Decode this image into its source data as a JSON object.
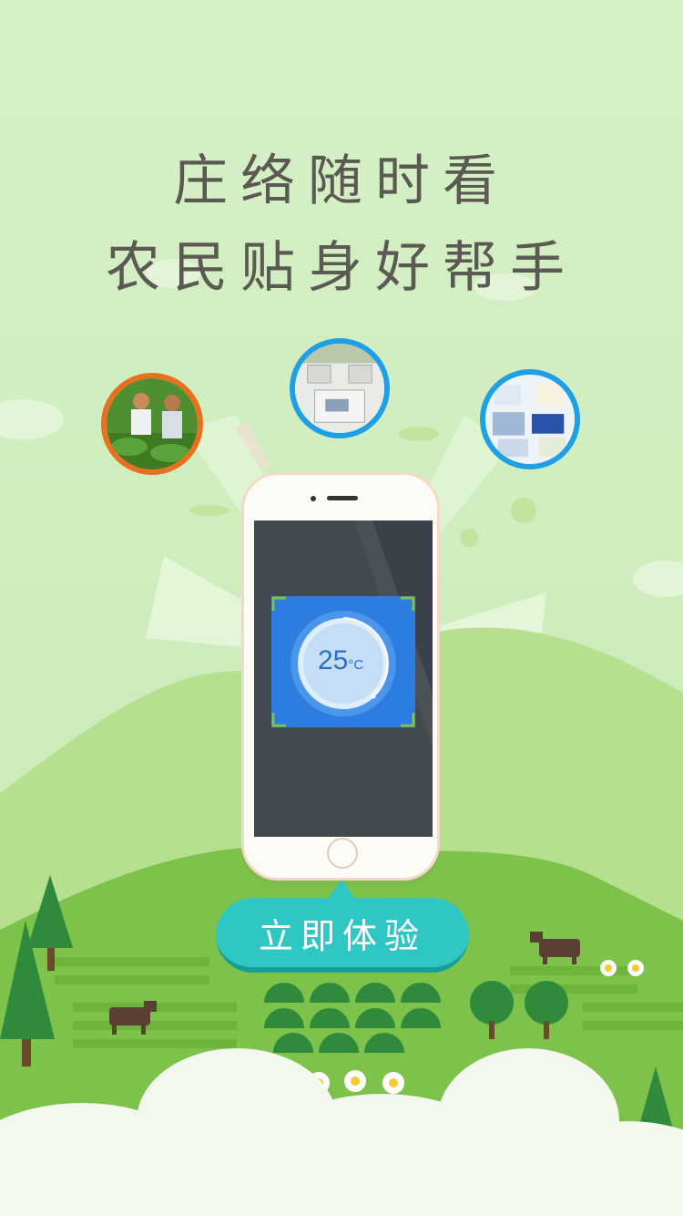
{
  "headline": {
    "line1": "庄络随时看",
    "line2": "农民贴身好帮手"
  },
  "phone_screen": {
    "temperature_value": "25",
    "temperature_unit": "°C"
  },
  "cta": {
    "label": "立即体验"
  },
  "bubbles": [
    {
      "name": "farmers-photo",
      "border_color": "#e8701e"
    },
    {
      "name": "device-photo",
      "border_color": "#1fa0e6"
    },
    {
      "name": "company-collage-photo",
      "border_color": "#1fa0e6"
    }
  ],
  "colors": {
    "background": "#d4efc4",
    "hill": "#7dc24a",
    "cta": "#2fc7c3",
    "temp_card": "#2d7ce0"
  }
}
